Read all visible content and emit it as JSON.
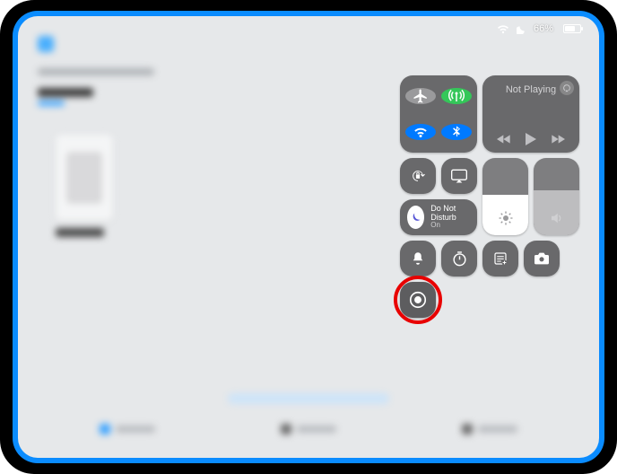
{
  "status_bar": {
    "battery_pct_label": "66%",
    "battery_pct_value": 66,
    "dnd_active": true
  },
  "control_center": {
    "media": {
      "label": "Not Playing",
      "close_label": "×"
    },
    "dnd": {
      "title": "Do Not Disturb",
      "subtitle": "On"
    },
    "brightness_pct": 52,
    "volume_pct": 58,
    "toggles": {
      "airplane": "airplane-mode",
      "cellular": "cellular-data",
      "wifi": "wifi",
      "bluetooth": "bluetooth"
    },
    "small_toggles": {
      "orientation_lock": "orientation-lock",
      "screen_mirroring": "screen-mirroring",
      "silent": "silent-mode",
      "timer": "timer",
      "notes": "notes-quick",
      "camera": "camera",
      "screen_record": "screen-record"
    }
  },
  "annotation": {
    "highlight_target": "screen-record-button"
  }
}
